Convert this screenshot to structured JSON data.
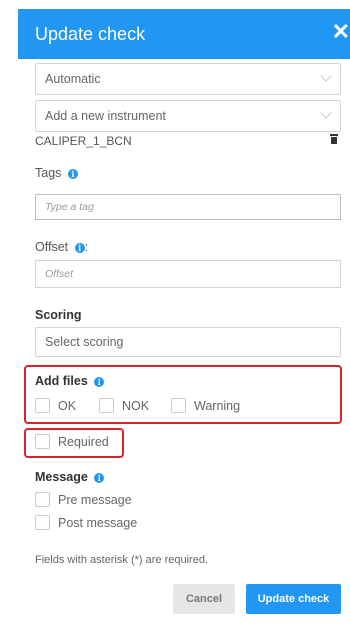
{
  "header": {
    "title": "Update check",
    "close_symbol": "✕"
  },
  "form": {
    "mode_select": "Automatic",
    "instrument_select": "Add a new instrument",
    "instrument_item": "CALIPER_1_BCN",
    "tags": {
      "label": "Tags",
      "placeholder": "Type a tag"
    },
    "offset": {
      "label": "Offset",
      "suffix": ":",
      "placeholder": "Offset"
    },
    "scoring": {
      "label": "Scoring",
      "select": "Select scoring"
    },
    "add_files": {
      "label": "Add files",
      "options": [
        "OK",
        "NOK",
        "Warning"
      ]
    },
    "required": "Required",
    "message": {
      "label": "Message",
      "options": [
        "Pre message",
        "Post message"
      ]
    },
    "footnote": "Fields with asterisk (*) are required."
  },
  "buttons": {
    "cancel": "Cancel",
    "update": "Update check"
  },
  "colors": {
    "primary": "#2196f3",
    "highlight": "#d9252a"
  },
  "icons": {
    "info": "info-icon",
    "trash": "trash-icon",
    "close": "close-icon",
    "chevron": "chevron-down-icon"
  }
}
